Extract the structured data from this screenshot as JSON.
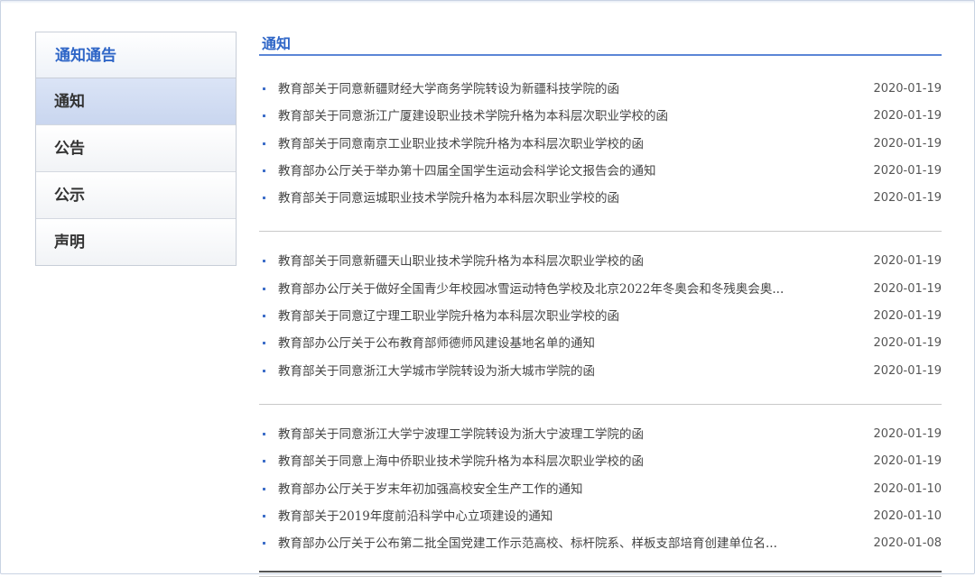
{
  "sidebar": {
    "title": "通知通告",
    "items": [
      {
        "label": "通知",
        "active": true
      },
      {
        "label": "公告",
        "active": false
      },
      {
        "label": "公示",
        "active": false
      },
      {
        "label": "声明",
        "active": false
      }
    ]
  },
  "main": {
    "title": "通知",
    "groups": [
      [
        {
          "title": "教育部关于同意新疆财经大学商务学院转设为新疆科技学院的函",
          "date": "2020-01-19"
        },
        {
          "title": "教育部关于同意浙江广厦建设职业技术学院升格为本科层次职业学校的函",
          "date": "2020-01-19"
        },
        {
          "title": "教育部关于同意南京工业职业技术学院升格为本科层次职业学校的函",
          "date": "2020-01-19"
        },
        {
          "title": "教育部办公厅关于举办第十四届全国学生运动会科学论文报告会的通知",
          "date": "2020-01-19"
        },
        {
          "title": "教育部关于同意运城职业技术学院升格为本科层次职业学校的函",
          "date": "2020-01-19"
        }
      ],
      [
        {
          "title": "教育部关于同意新疆天山职业技术学院升格为本科层次职业学校的函",
          "date": "2020-01-19"
        },
        {
          "title": "教育部办公厅关于做好全国青少年校园冰雪运动特色学校及北京2022年冬奥会和冬残奥会奥...",
          "date": "2020-01-19"
        },
        {
          "title": "教育部关于同意辽宁理工职业学院升格为本科层次职业学校的函",
          "date": "2020-01-19"
        },
        {
          "title": "教育部办公厅关于公布教育部师德师风建设基地名单的通知",
          "date": "2020-01-19"
        },
        {
          "title": "教育部关于同意浙江大学城市学院转设为浙大城市学院的函",
          "date": "2020-01-19"
        }
      ],
      [
        {
          "title": "教育部关于同意浙江大学宁波理工学院转设为浙大宁波理工学院的函",
          "date": "2020-01-19"
        },
        {
          "title": "教育部关于同意上海中侨职业技术学院升格为本科层次职业学校的函",
          "date": "2020-01-19"
        },
        {
          "title": "教育部办公厅关于岁末年初加强高校安全生产工作的通知",
          "date": "2020-01-10"
        },
        {
          "title": "教育部关于2019年度前沿科学中心立项建设的通知",
          "date": "2020-01-10"
        },
        {
          "title": "教育部办公厅关于公布第二批全国党建工作示范高校、标杆院系、样板支部培育创建单位名...",
          "date": "2020-01-08"
        }
      ]
    ]
  },
  "colors": {
    "accent": "#2f66c7",
    "rule": "#5b86d6",
    "active_bg": "#c9d6ef"
  }
}
